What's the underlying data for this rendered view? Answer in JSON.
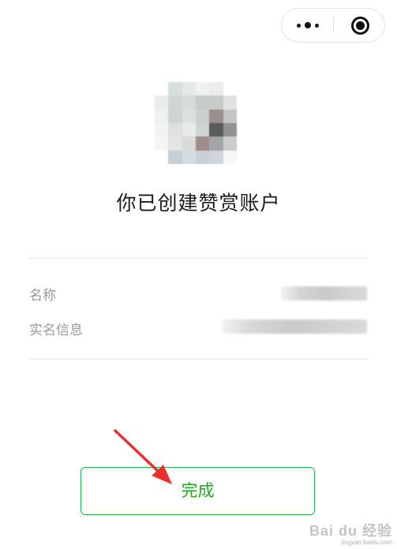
{
  "capsule": {
    "more_icon": "more-dots-icon",
    "close_icon": "close-target-icon"
  },
  "avatar": {
    "tiles": [
      "#ffffff",
      "#d9dfdf",
      "#e4e9e8",
      "#eef1ef",
      "#e9ecea",
      "#ffffff",
      "#e9edec",
      "#cfd6d5",
      "#d6dcdb",
      "#c6cccb",
      "#c8ccc8",
      "#dfe3e1",
      "#eef1f0",
      "#cdd4d3",
      "#dbe1e0",
      "#c8d1ce",
      "#9a8f8a",
      "#c2c7c5",
      "#f2f4f3",
      "#dde2e0",
      "#e6eae9",
      "#cfd5d2",
      "#585a5c",
      "#8f9294",
      "#f4f6f5",
      "#e2e6e3",
      "#d8dcd9",
      "#9f8c8b",
      "#a6a3a8",
      "#cacdd0",
      "#ffffff",
      "#c7ced4",
      "#d4dce2",
      "#c8d0d7",
      "#cfd6dc",
      "#f6f7f8"
    ]
  },
  "title": "你已创建赞赏账户",
  "info": {
    "name_label": "名称",
    "real_name_label": "实名信息"
  },
  "done_button": {
    "label": "完成",
    "accent": "#1aad19"
  },
  "annotation": {
    "color": "#e8312f"
  },
  "watermark": {
    "main": "Bai du 经验",
    "sub": "jingyan.baidu.com"
  }
}
